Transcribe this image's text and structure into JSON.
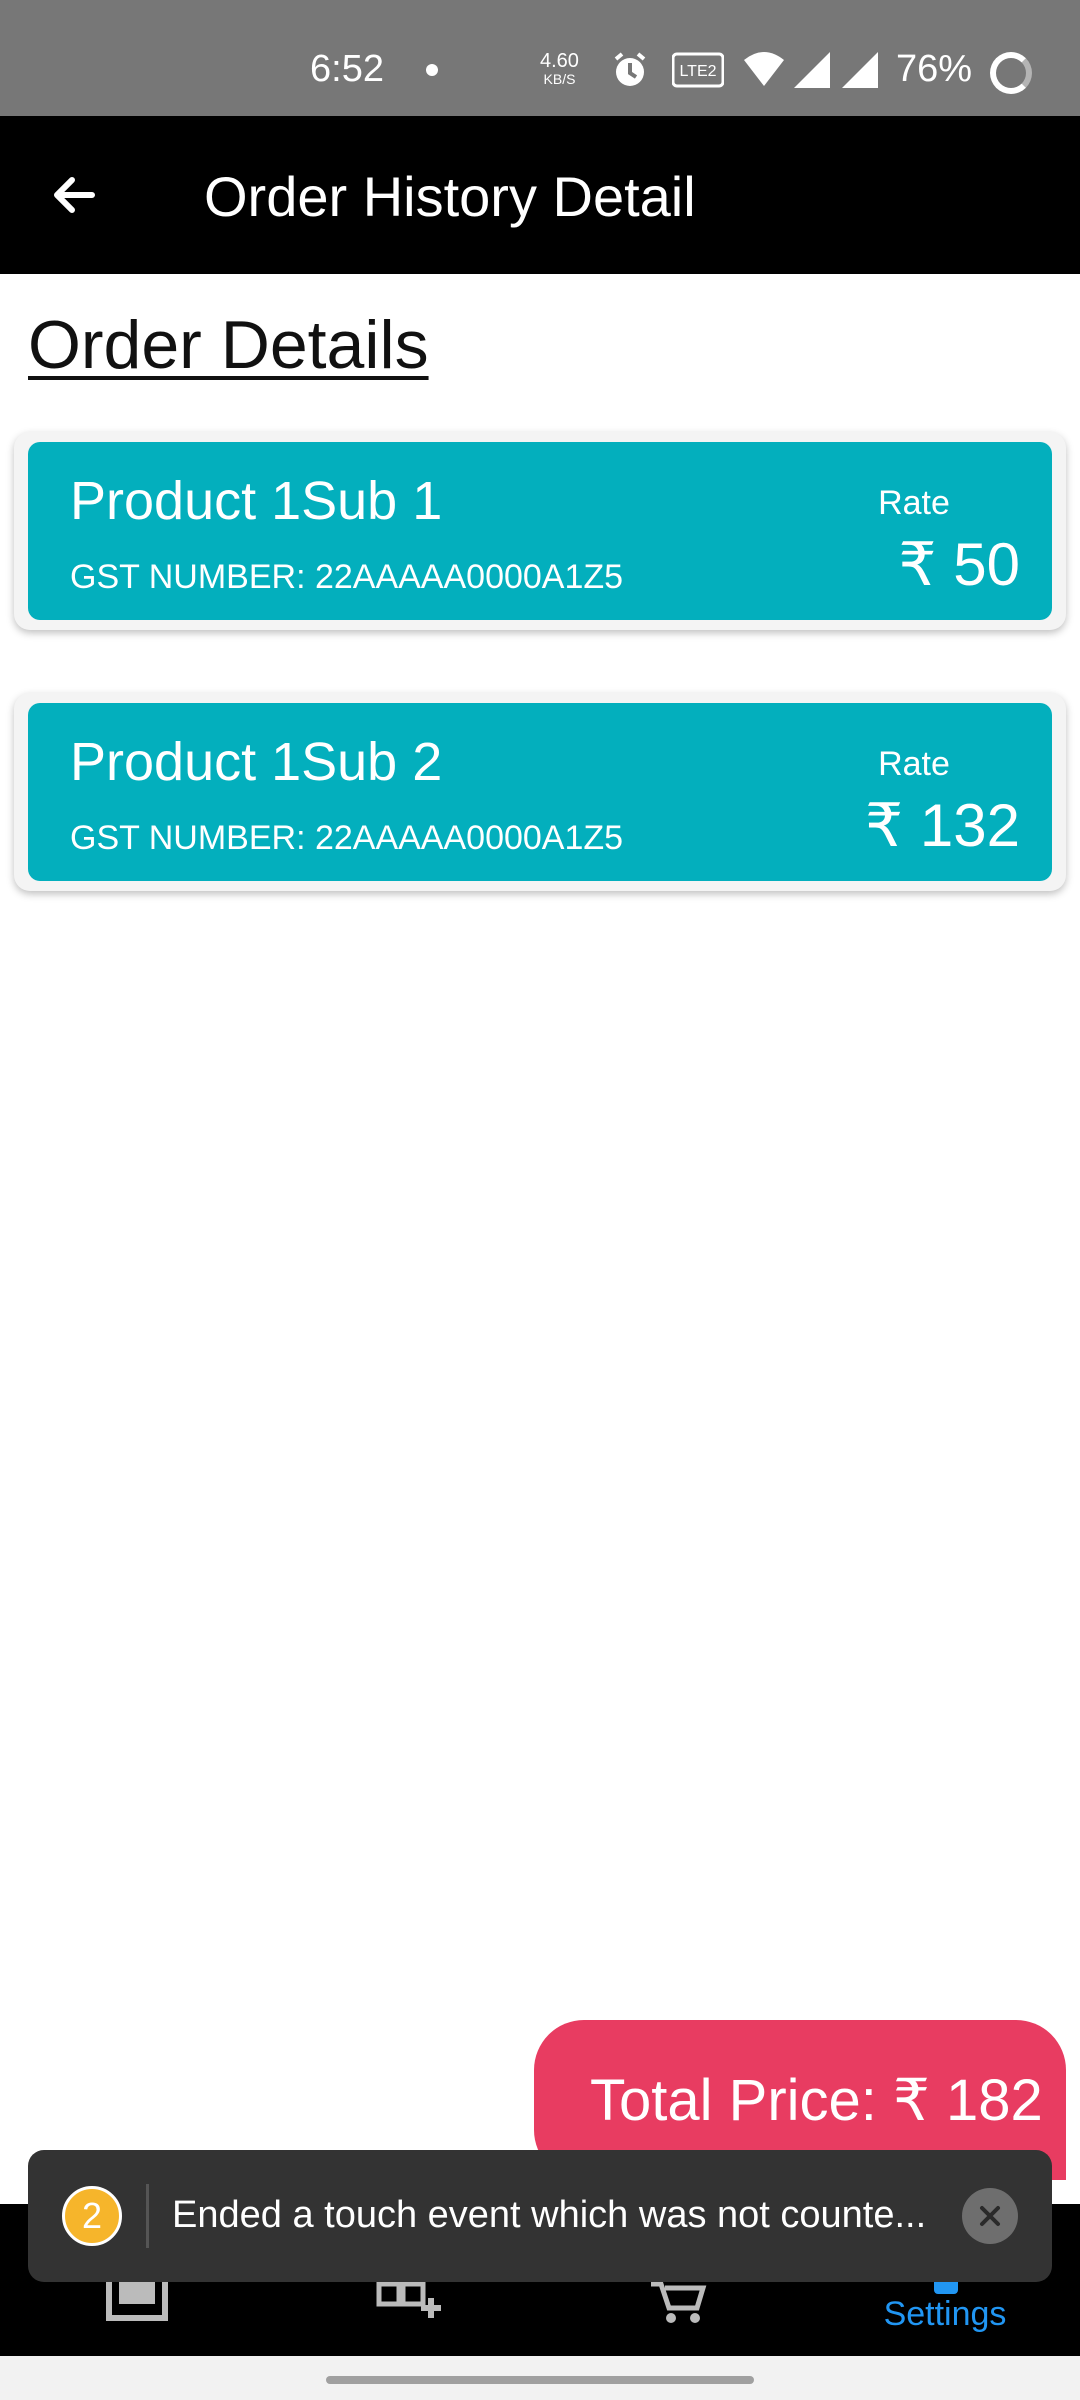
{
  "status_bar": {
    "time": "6:52",
    "net_speed_value": "4.60",
    "net_speed_unit": "KB/S",
    "network_label": "Vo) 1 LTE 2",
    "battery": "76%"
  },
  "app_bar": {
    "title": "Order History Detail",
    "back_icon": "arrow-left-icon"
  },
  "page": {
    "section_title": "Order Details"
  },
  "products": [
    {
      "name": "Product 1Sub 1",
      "gst": "GST NUMBER: 22AAAAA0000A1Z5",
      "rate_label": "Rate",
      "rate": "₹ 50"
    },
    {
      "name": "Product 1Sub 2",
      "gst": "GST NUMBER: 22AAAAA0000A1Z5",
      "rate_label": "Rate",
      "rate": "₹ 132"
    }
  ],
  "total": {
    "label": "Total Price: ₹ 182"
  },
  "bottom_nav": {
    "items": [
      {
        "icon": "inbox-icon"
      },
      {
        "icon": "add-category-icon"
      },
      {
        "icon": "cart-icon"
      },
      {
        "icon": "settings-icon",
        "label": "Settings"
      }
    ],
    "active_color": "#2196f3"
  },
  "toast": {
    "badge_count": "2",
    "message": "Ended a touch event which was not counte..."
  },
  "colors": {
    "card": "#03afbd",
    "total": "#e83c61",
    "app_bar": "#000000"
  }
}
